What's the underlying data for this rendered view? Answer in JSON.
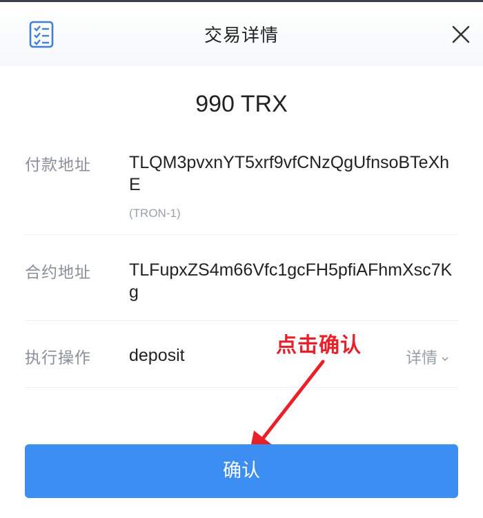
{
  "header": {
    "title": "交易详情",
    "left_icon": "list-check-icon",
    "right_icon": "close-icon"
  },
  "amount": "990 TRX",
  "details": {
    "payer": {
      "label": "付款地址",
      "value": "TLQM3pvxnYT5xrf9vfCNzQgUfnsoBTeXhE",
      "network": "(TRON-1)"
    },
    "contract": {
      "label": "合约地址",
      "value": "TLFupxZS4m66Vfc1gcFH5pfiAFhmXsc7Kg"
    },
    "action": {
      "label": "执行操作",
      "value": "deposit",
      "detail_link": "详情"
    }
  },
  "annotation": {
    "text": "点击确认",
    "color": "#e8202a"
  },
  "confirm_button": {
    "label": "确认",
    "color": "#3d8ef2"
  }
}
